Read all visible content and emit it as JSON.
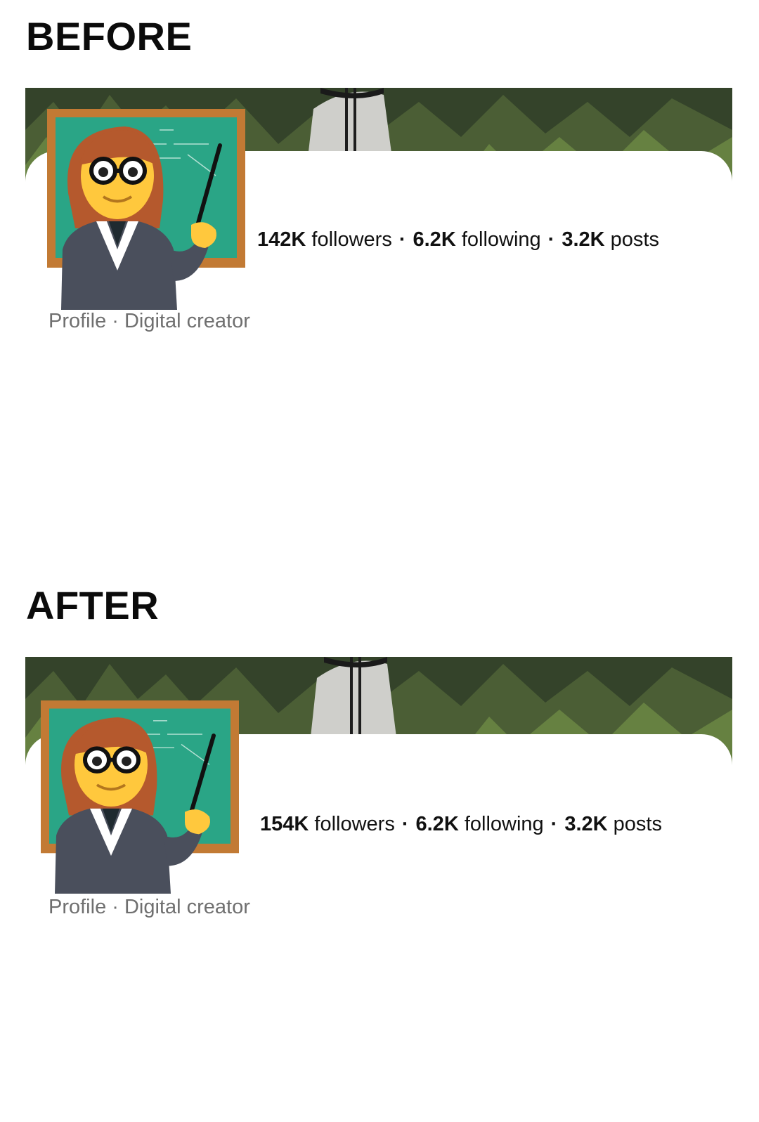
{
  "before": {
    "heading": "BEFORE",
    "stats": {
      "followers_count": "142K",
      "followers_label": "followers",
      "following_count": "6.2K",
      "following_label": "following",
      "posts_count": "3.2K",
      "posts_label": "posts"
    },
    "subline": "Profile · Digital creator"
  },
  "after": {
    "heading": "AFTER",
    "stats": {
      "followers_count": "154K",
      "followers_label": "followers",
      "following_count": "6.2K",
      "following_label": "following",
      "posts_count": "3.2K",
      "posts_label": "posts"
    },
    "subline": "Profile · Digital creator"
  },
  "avatar_icon": "teacher-emoji-icon",
  "separator": "·",
  "colors": {
    "heading": "#0b0b0b",
    "subline": "#6f6f6f",
    "chalkboard": "#2aa586",
    "board_frame": "#c27a34"
  }
}
